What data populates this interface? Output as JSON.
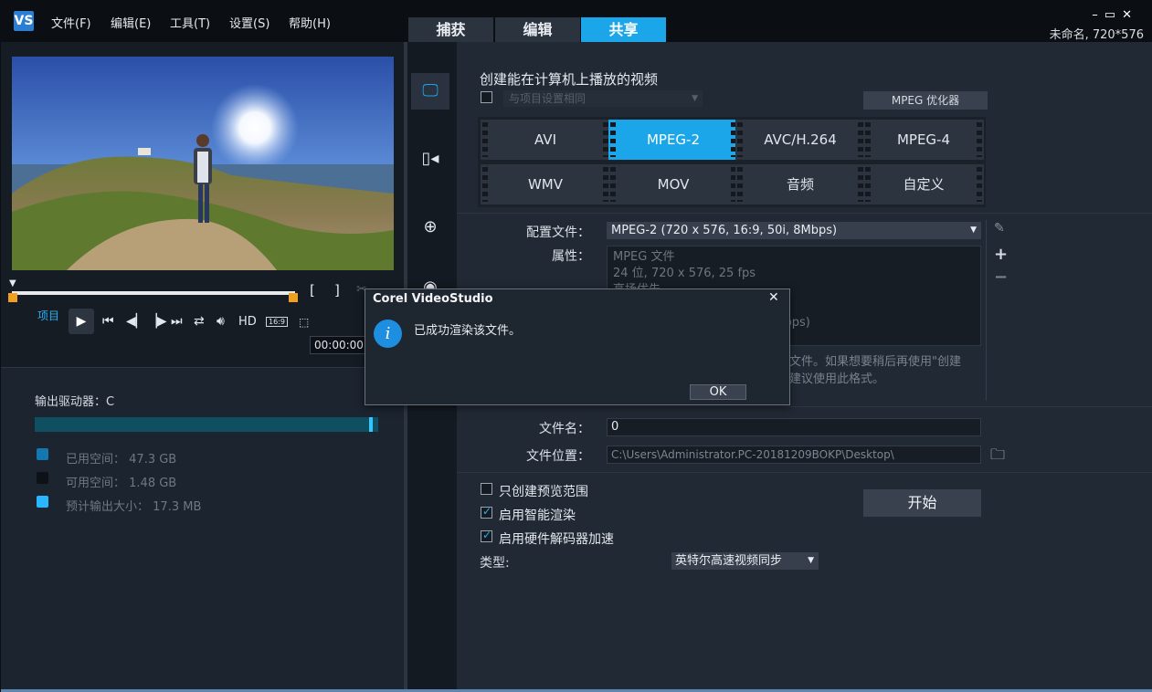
{
  "app": {
    "logo": "VS",
    "project_info": "未命名, 720*576"
  },
  "menu": [
    "文件(F)",
    "编辑(E)",
    "工具(T)",
    "设置(S)",
    "帮助(H)"
  ],
  "tabs": [
    {
      "label": "捕获",
      "active": false
    },
    {
      "label": "编辑",
      "active": false
    },
    {
      "label": "共享",
      "active": true
    }
  ],
  "window_controls": {
    "minimize": "–",
    "restore": "▭",
    "close": "✕"
  },
  "player": {
    "project_label": "项目",
    "hd_label": "HD",
    "ratio_label": "16:9",
    "timecode": "00:00:00"
  },
  "storage": {
    "drive_label": "输出驱动器：C",
    "used": {
      "label": "已用空间：",
      "value": "47.3 GB",
      "color": "#1577b0"
    },
    "free": {
      "label": "可用空间：",
      "value": "1.48 GB",
      "color": "#0d1218"
    },
    "estimate": {
      "label": "预计输出大小：",
      "value": "17.3 MB",
      "color": "#29b6ff"
    }
  },
  "sidebar_icons": [
    "computer-icon",
    "device-icon",
    "web-icon",
    "disc-icon"
  ],
  "share": {
    "title": "创建能在计算机上播放的视频",
    "same_as_project": "与项目设置相同",
    "mpeg_optimizer": "MPEG 优化器",
    "formats": [
      {
        "label": "AVI",
        "active": false
      },
      {
        "label": "MPEG-2",
        "active": true
      },
      {
        "label": "AVC/H.264",
        "active": false
      },
      {
        "label": "MPEG-4",
        "active": false
      },
      {
        "label": "WMV",
        "active": false
      },
      {
        "label": "MOV",
        "active": false
      },
      {
        "label": "音频",
        "active": false
      },
      {
        "label": "自定义",
        "active": false
      }
    ],
    "profile_label": "配置文件：",
    "profile_value": "MPEG-2 (720 x 576, 16:9, 50i, 8Mbps)",
    "properties_label": "属性：",
    "properties_lines": [
      "MPEG 文件",
      "24 位, 720 x 576, 25 fps",
      "高场优先",
      "",
      "kbps)"
    ],
    "description_lines": [
      "文件。如果想要稍后再使用\"创建",
      "建议使用此格式。"
    ],
    "filename_label": "文件名：",
    "filename_value": "0",
    "location_label": "文件位置：",
    "location_value": "C:\\Users\\Administrator.PC-20181209BOKP\\Desktop\\",
    "opt_preview_range": "只创建预览范围",
    "opt_smart_render": "启用智能渲染",
    "opt_hw_decoder": "启用硬件解码器加速",
    "opt_states": {
      "preview_range": false,
      "smart_render": true,
      "hw_decoder": true
    },
    "start_button": "开始",
    "type_label": "类型:",
    "type_value": "英特尔高速视频同步"
  },
  "dialog": {
    "title": "Corel VideoStudio",
    "message": "已成功渲染该文件。",
    "ok": "OK",
    "close": "✕",
    "info_glyph": "i"
  }
}
